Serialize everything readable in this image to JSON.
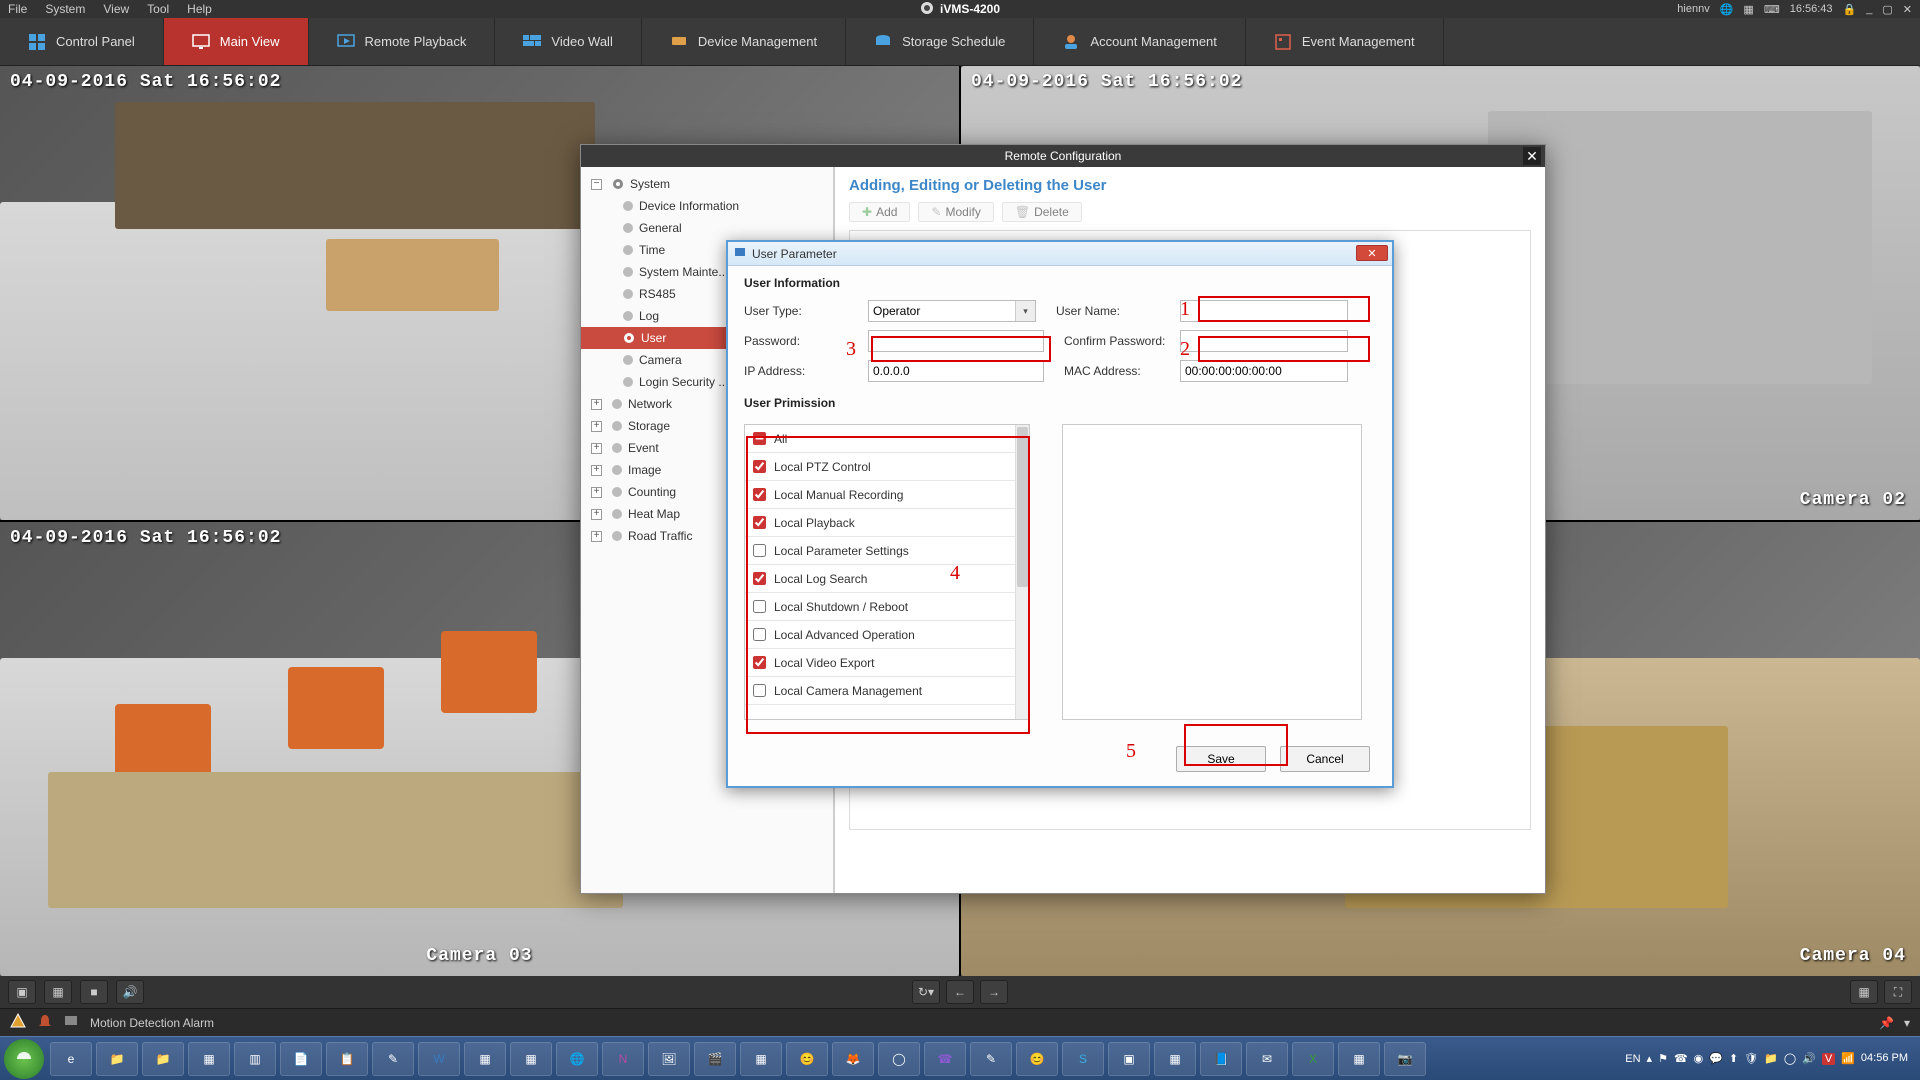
{
  "sysmenu": {
    "items": [
      "File",
      "System",
      "View",
      "Tool",
      "Help"
    ],
    "title": "iVMS-4200",
    "user": "hiennv",
    "time": "16:56:43"
  },
  "navtabs": [
    "Control Panel",
    "Main View",
    "Remote Playback",
    "Video Wall",
    "Device Management",
    "Storage Schedule",
    "Account Management",
    "Event Management"
  ],
  "cams": {
    "ts": "04-09-2016 Sat 16:56:02",
    "c2": "Camera 02",
    "c3": "Camera 03",
    "c4": "Camera 04"
  },
  "remotewin": {
    "title": "Remote Configuration",
    "tree": {
      "system": "System",
      "items": [
        "Device Information",
        "General",
        "Time",
        "System Mainte...",
        "RS485",
        "Log",
        "User",
        "Camera",
        "Login Security ..."
      ],
      "roots": [
        "Network",
        "Storage",
        "Event",
        "Image",
        "Counting",
        "Heat Map",
        "Road Traffic"
      ]
    },
    "heading": "Adding, Editing or Deleting the User",
    "actions": {
      "add": "Add",
      "modify": "Modify",
      "delete": "Delete"
    }
  },
  "userparam": {
    "title": "User Parameter",
    "sec1": "User Information",
    "labels": {
      "usertype": "User Type:",
      "username": "User Name:",
      "password": "Password:",
      "confirm": "Confirm Password:",
      "ip": "IP Address:",
      "mac": "MAC Address:"
    },
    "values": {
      "usertype": "Operator",
      "ip": "0.0.0.0",
      "mac": "00:00:00:00:00:00"
    },
    "sec2": "User Primission",
    "perms": [
      "All",
      "Local PTZ Control",
      "Local Manual Recording",
      "Local Playback",
      "Local Parameter Settings",
      "Local Log Search",
      "Local Shutdown / Reboot",
      "Local Advanced Operation",
      "Local Video Export",
      "Local Camera Management"
    ],
    "checked": [
      false,
      true,
      true,
      true,
      false,
      true,
      false,
      false,
      true,
      false
    ],
    "partial": [
      true,
      false,
      false,
      false,
      false,
      false,
      false,
      false,
      false,
      false
    ],
    "buttons": {
      "save": "Save",
      "cancel": "Cancel"
    }
  },
  "annotations": {
    "n1": "1",
    "n2": "2",
    "n3": "3",
    "n4": "4",
    "n5": "5"
  },
  "alarm": {
    "text": "Motion Detection Alarm"
  },
  "tray": {
    "lang": "EN",
    "time": "04:56 PM"
  }
}
